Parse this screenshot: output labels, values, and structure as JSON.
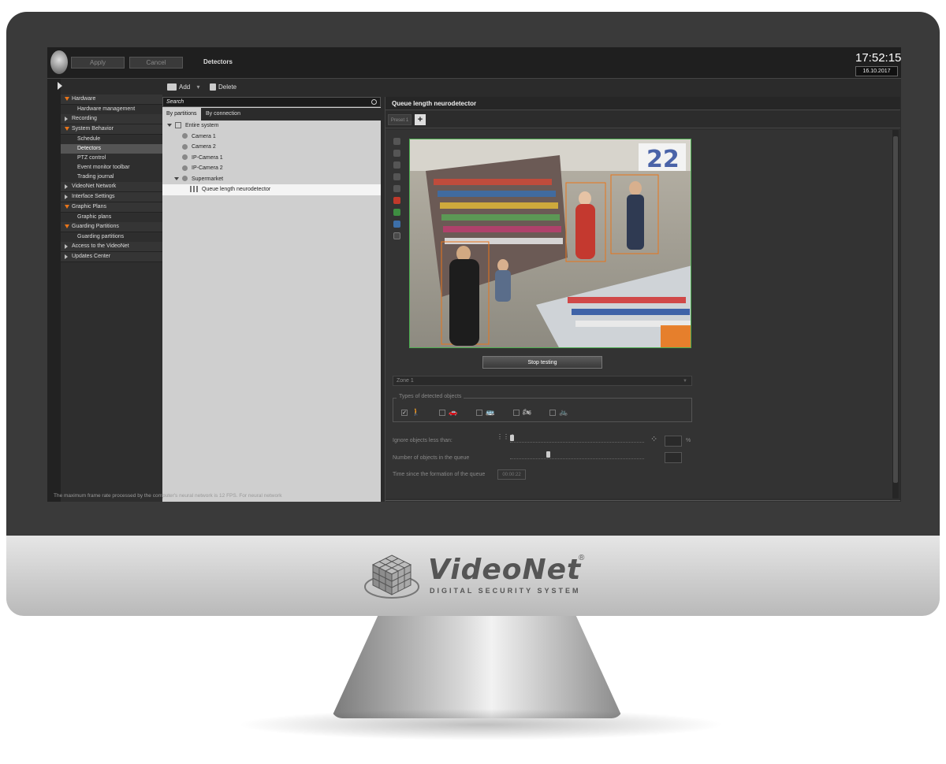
{
  "topbar": {
    "apply": "Apply",
    "cancel": "Cancel",
    "title": "Detectors",
    "time": "17:52:15",
    "date": "16.10.2017"
  },
  "toolbar": {
    "add": "Add",
    "delete": "Delete"
  },
  "sidebar": {
    "items": [
      {
        "label": "Hardware",
        "open": true,
        "children": [
          "Hardware management"
        ]
      },
      {
        "label": "Recording",
        "open": false,
        "children": []
      },
      {
        "label": "System Behavior",
        "open": true,
        "children": [
          "Schedule",
          "Detectors",
          "PTZ control",
          "Event monitor toolbar",
          "Trading journal"
        ]
      },
      {
        "label": "VideoNet Network",
        "open": false,
        "children": []
      },
      {
        "label": "Interface Settings",
        "open": false,
        "children": []
      },
      {
        "label": "Graphic Plans",
        "open": true,
        "children": [
          "Graphic plans"
        ]
      },
      {
        "label": "Guarding Partitions",
        "open": true,
        "children": [
          "Guarding partitions"
        ]
      },
      {
        "label": "Access to the VideoNet",
        "open": false,
        "children": []
      },
      {
        "label": "Updates Center",
        "open": false,
        "children": []
      }
    ],
    "selected": "Detectors"
  },
  "mid": {
    "search_placeholder": "Search",
    "tabs": [
      "By partitions",
      "By connection"
    ],
    "tree": {
      "root": "Entire system",
      "cameras": [
        "Camera 1",
        "Camera 2",
        "IP-Camera 1",
        "IP-Camera 2"
      ],
      "group": "Supermarket",
      "detector": "Queue length neurodetector"
    }
  },
  "right": {
    "title": "Queue length neurodetector",
    "preset": "Preset 1",
    "stop_button": "Stop testing",
    "zone": "Zone 1",
    "types_legend": "Types of detected objects",
    "ignore_label": "Ignore objects less than:",
    "queue_label": "Number of objects in the queue",
    "time_label": "Time since the formation of the queue",
    "time_value": "00:00:22",
    "percent": "%",
    "note": "The maximum frame rate processed by the computer's neural network is 12 FPS. For neural network"
  },
  "brand": {
    "name": "VideoNet",
    "reg": "®",
    "tagline": "DIGITAL SECURITY SYSTEM"
  },
  "colors": {
    "accent": "#e8751a",
    "video_border": "#4caf50"
  }
}
